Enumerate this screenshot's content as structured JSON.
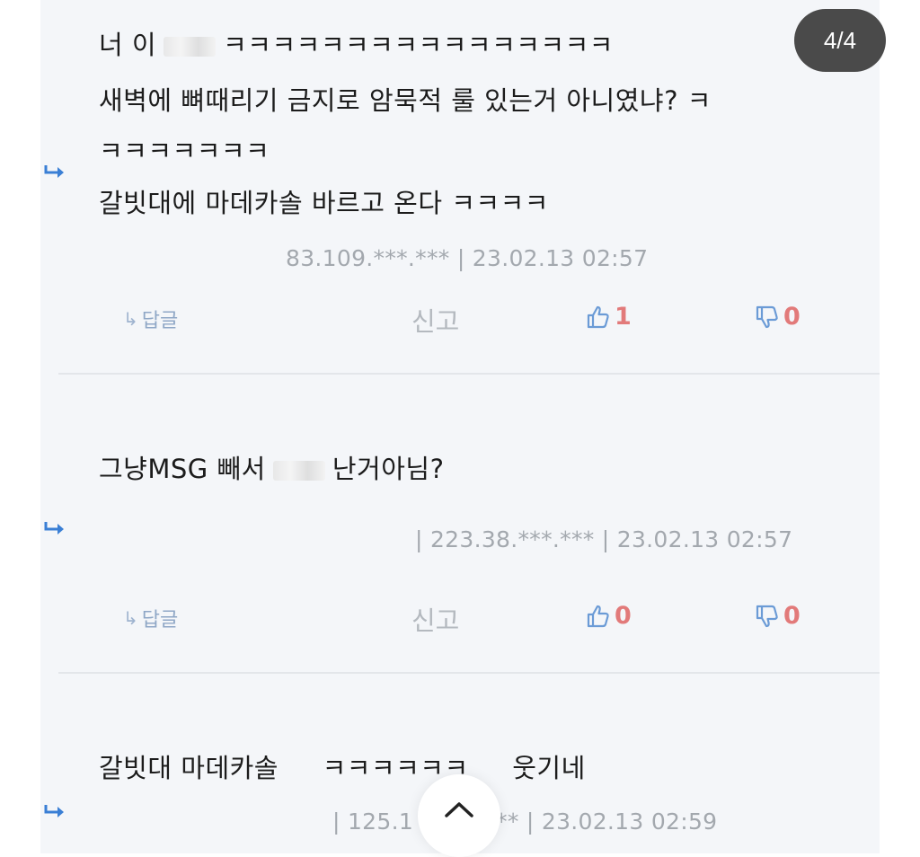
{
  "page_indicator": "4/4",
  "colors": {
    "accent": "#6b9bd6",
    "vote_count": "#e27a7a",
    "reply_arrow": "#3a7fd5"
  },
  "comments": [
    {
      "lines": [
        {
          "before": "너 이",
          "after": "ㅋㅋㅋㅋㅋㅋㅋㅋㅋㅋㅋㅋㅋㅋㅋㅋ"
        },
        "새벽에 뼈때리기 금지로 암묵적 룰 있는거 아니였냐? ㅋ",
        "ㅋㅋㅋㅋㅋㅋㅋ",
        "갈빗대에 마데카솔 바르고 온다 ㅋㅋㅋㅋ"
      ],
      "meta": "83.109.***.*** | 23.02.13 02:57",
      "reply_label": "답글",
      "report_label": "신고",
      "likes": "1",
      "dislikes": "0"
    },
    {
      "line": {
        "before": "그냥MSG 빼서",
        "after": "난거아님?"
      },
      "meta": "| 223.38.***.*** | 23.02.13 02:57",
      "reply_label": "답글",
      "report_label": "신고",
      "likes": "0",
      "dislikes": "0"
    },
    {
      "line": "갈빗대 마데카솔     ㅋㅋㅋㅋㅋㅋ     웃기네",
      "meta_before": "| 125.1",
      "meta_after": "** | 23.02.13 02:59"
    }
  ]
}
